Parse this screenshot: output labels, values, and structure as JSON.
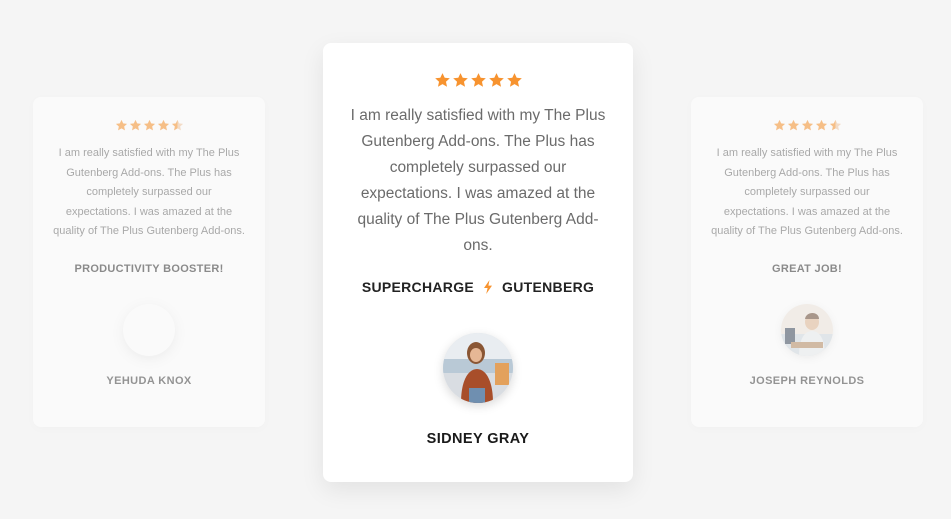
{
  "colors": {
    "star": "#f7932f",
    "star_empty": "#f3c9a2",
    "bolt": "#f7932f"
  },
  "testimonials": [
    {
      "rating": 4.5,
      "quote": "I am really satisfied with my The Plus Gutenberg Add-ons. The Plus has completely surpassed our expectations. I was amazed at the quality of The Plus Gutenberg Add-ons.",
      "tagline": "PRODUCTIVITY BOOSTER!",
      "name": "YEHUDA KNOX"
    },
    {
      "rating": 5,
      "quote": "I am really satisfied with my The Plus Gutenberg Add-ons. The Plus has completely surpassed our expectations. I was amazed at the quality of The Plus Gutenberg Add-ons.",
      "tagline_left": "SUPERCHARGE",
      "tagline_icon": "lightning-bolt-icon",
      "tagline_right": "GUTENBERG",
      "name": "SIDNEY GRAY"
    },
    {
      "rating": 4.5,
      "quote": "I am really satisfied with my The Plus Gutenberg Add-ons. The Plus has completely surpassed our expectations. I was amazed at the quality of The Plus Gutenberg Add-ons.",
      "tagline": "GREAT JOB!",
      "name": "JOSEPH REYNOLDS"
    }
  ]
}
